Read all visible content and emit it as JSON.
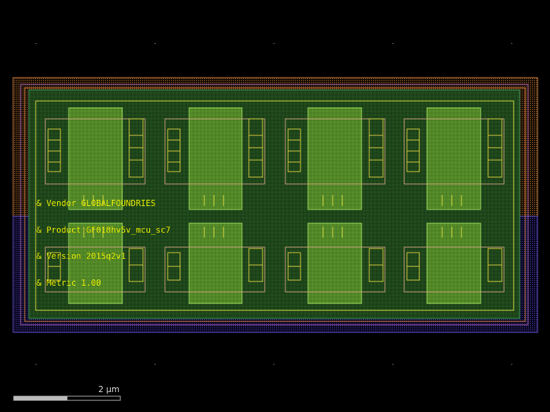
{
  "layout": {
    "labels": [
      "& Vendor GLOBALFOUNDRIES",
      "& Product GF018hv5v_mcu_sc7",
      "& Version 2015q2v1",
      "& Metric 1.00"
    ],
    "scale_bar": {
      "label": "2 µm"
    },
    "colors": {
      "background": "#000000",
      "label": "#e6e600",
      "nwell": "#c8a060",
      "pwell": "#5a48c8",
      "diffusion": "#3c8c3c",
      "poly": "#e0e040",
      "metal": "#70d040",
      "contact": "#ddbb88",
      "grid_dot": "#cccccc"
    }
  }
}
